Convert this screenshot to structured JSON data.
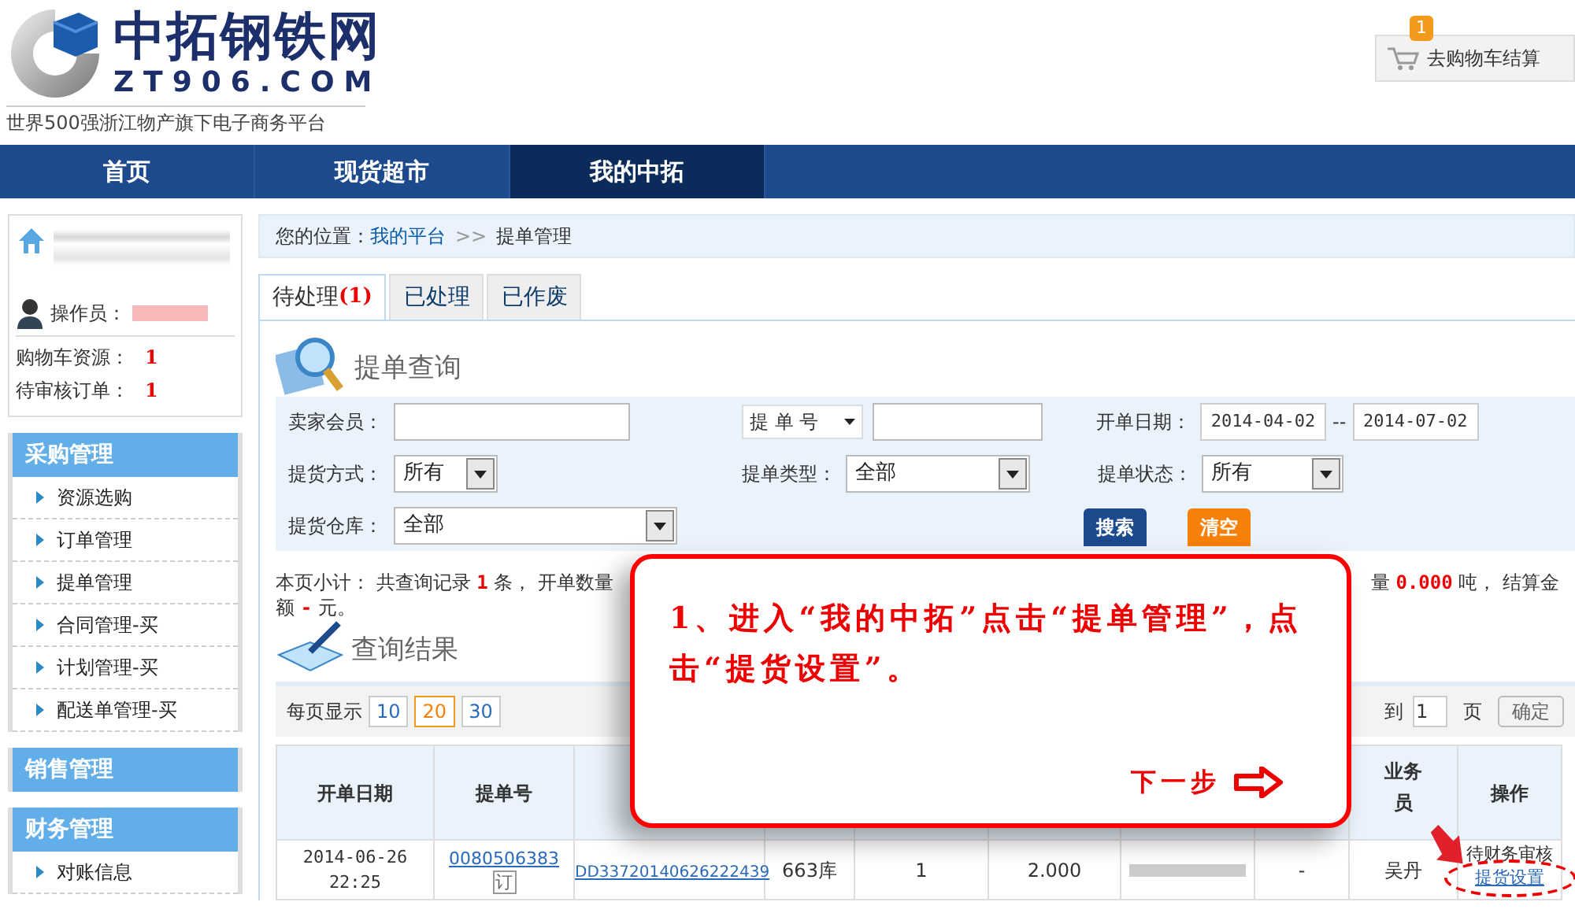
{
  "logo": {
    "name": "中拓钢铁网",
    "domain": "ZT906.COM",
    "slogan": "世界500强浙江物产旗下电子商务平台"
  },
  "cart": {
    "badge": "1",
    "label": "去购物车结算"
  },
  "nav": [
    {
      "label": "首页",
      "selected": false
    },
    {
      "label": "现货超市",
      "selected": false
    },
    {
      "label": "我的中拓",
      "selected": true
    }
  ],
  "user_panel": {
    "operator_label": "操作员：",
    "stats": [
      {
        "label": "购物车资源：",
        "value": "1"
      },
      {
        "label": "待审核订单：",
        "value": "1"
      }
    ]
  },
  "sidebar": [
    {
      "title": "采购管理",
      "items": [
        "资源选购",
        "订单管理",
        "提单管理",
        "合同管理-买",
        "计划管理-买",
        "配送单管理-买"
      ]
    },
    {
      "title": "销售管理"
    },
    {
      "title": "财务管理",
      "items": [
        "对账信息"
      ]
    }
  ],
  "breadcrumb": {
    "prefix": "您的位置：",
    "link": "我的平台",
    "separator": ">>",
    "current": "提单管理"
  },
  "tabs": [
    {
      "label": "待处理",
      "count": "(1)",
      "selected": true
    },
    {
      "label": "已处理",
      "selected": false
    },
    {
      "label": "已作废",
      "selected": false
    }
  ],
  "query": {
    "title": "提单查询",
    "seller_label": "卖家会员：",
    "number_select": "提 单 号",
    "date_label": "开单日期：",
    "date_from": "2014-04-02",
    "date_sep": "--",
    "date_to": "2014-07-02",
    "method_label": "提货方式：",
    "method_value": "所有",
    "type_label": "提单类型：",
    "type_value": "全部",
    "status_label": "提单状态：",
    "status_value": "所有",
    "warehouse_label": "提货仓库：",
    "warehouse_value": "全部",
    "search_button": "搜索",
    "clear_button": "清空"
  },
  "summary": {
    "left": "本页小计： 共查询记录 **1** 条， 开单数量",
    "right": "量 **0.000** 吨， 结算金",
    "line2": "额 **-** 元。"
  },
  "results": {
    "title": "查询结果",
    "page_size_label": "每页显示",
    "page_sizes": [
      {
        "label": "10",
        "selected": false
      },
      {
        "label": "20",
        "selected": true
      },
      {
        "label": "30",
        "selected": false
      }
    ],
    "goto_label": "到",
    "goto_value": "1",
    "page_unit": "页",
    "confirm": "确定"
  },
  "table": {
    "columns": [
      "开单日期",
      "提单号",
      null,
      null,
      null,
      null,
      null,
      null,
      "业务员",
      "操作"
    ],
    "rows": [
      {
        "date": "2014-06-26",
        "time": "22:25",
        "bill_no": "0080506383",
        "bill_tag": "订",
        "order_no": "DD33720140626222439",
        "warehouse": "663库",
        "quantity": "1",
        "weight": "2.000",
        "amount": "-",
        "salesperson": "吴丹",
        "status": "待财务审核",
        "action": "提货设置"
      }
    ]
  },
  "guide": {
    "text": "1、进入“我的中拓”点击“提单管理”，点击“提货设置”。",
    "next": "下一步"
  }
}
